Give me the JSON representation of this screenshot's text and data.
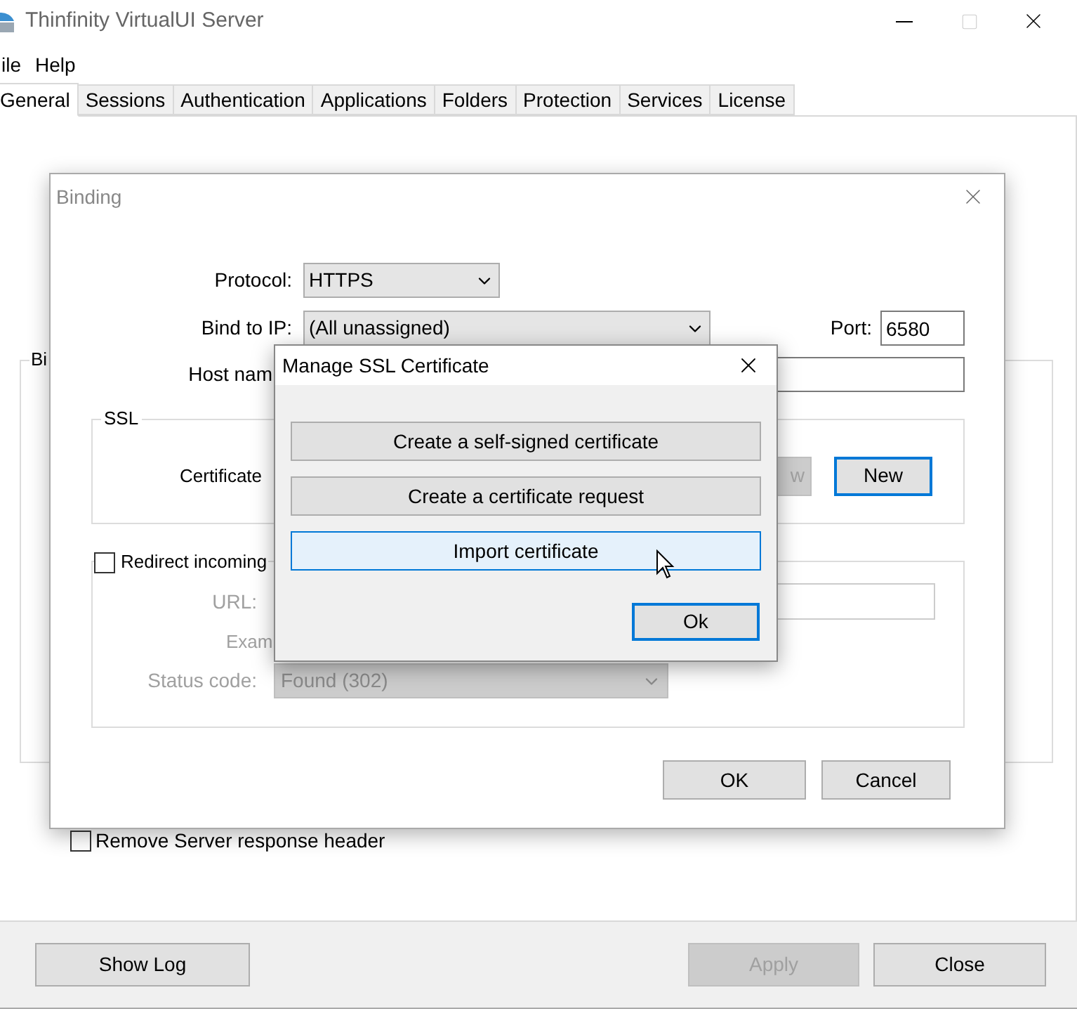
{
  "window": {
    "title": "Thinfinity VirtualUI Server"
  },
  "menu": [
    {
      "label": "ile"
    },
    {
      "label": "Help"
    }
  ],
  "tabs": [
    {
      "label": "General",
      "selected": true
    },
    {
      "label": "Sessions",
      "selected": false
    },
    {
      "label": "Authentication",
      "selected": false
    },
    {
      "label": "Applications",
      "selected": false
    },
    {
      "label": "Folders",
      "selected": false
    },
    {
      "label": "Protection",
      "selected": false
    },
    {
      "label": "Services",
      "selected": false
    },
    {
      "label": "License",
      "selected": false
    }
  ],
  "general": {
    "group_label": "Bi",
    "remove_header": {
      "label": "Remove Server response header",
      "checked": false
    }
  },
  "binding_dialog": {
    "title": "Binding",
    "protocol": {
      "label": "Protocol:",
      "value": "HTTPS"
    },
    "bind_ip": {
      "label": "Bind to IP:",
      "value": "(All unassigned)"
    },
    "port": {
      "label": "Port:",
      "value": "6580"
    },
    "host": {
      "label": "Host nam"
    },
    "ssl": {
      "title": "SSL",
      "certificate_label": "Certificate",
      "view_button": {
        "label": "w",
        "disabled": true
      },
      "new_button": {
        "label": "New",
        "focused": true
      }
    },
    "redirect": {
      "label": "Redirect incoming",
      "checked": false,
      "disabled": true,
      "url_label": "URL:",
      "example": "Exam",
      "status_label": "Status code:",
      "status_value": "Found (302)"
    },
    "buttons": [
      {
        "label": "OK"
      },
      {
        "label": "Cancel"
      }
    ]
  },
  "ssl_dialog": {
    "title": "Manage SSL Certificate",
    "options": [
      {
        "label": "Create a self-signed certificate",
        "hovered": false
      },
      {
        "label": "Create a certificate request",
        "hovered": false
      },
      {
        "label": "Import certificate",
        "hovered": true
      }
    ],
    "ok": {
      "label": "Ok",
      "focused": true
    }
  },
  "footer": {
    "buttons": [
      {
        "label": "Show Log",
        "disabled": false
      },
      {
        "label": "Apply",
        "disabled": true
      },
      {
        "label": "Close",
        "disabled": false
      }
    ]
  }
}
